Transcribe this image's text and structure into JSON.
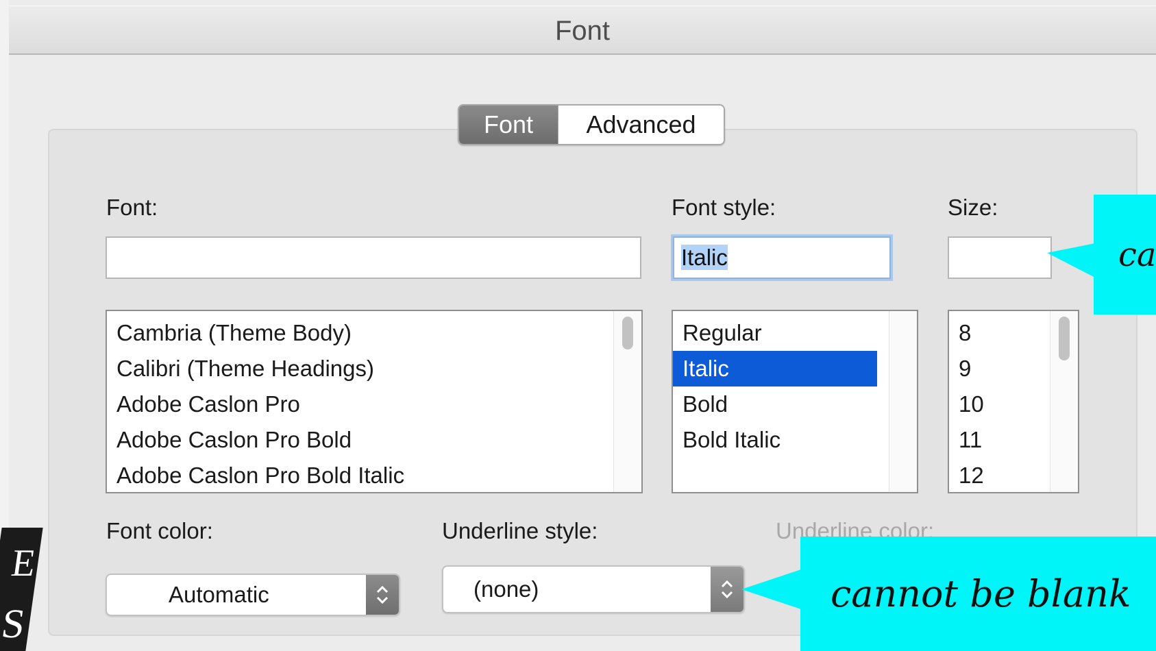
{
  "window": {
    "title": "Font"
  },
  "tabs": [
    {
      "label": "Font",
      "active": true
    },
    {
      "label": "Advanced",
      "active": false
    }
  ],
  "font": {
    "label": "Font:",
    "value": "",
    "list": [
      "Cambria (Theme Body)",
      "Calibri (Theme Headings)",
      "Adobe Caslon Pro",
      "Adobe Caslon Pro Bold",
      "Adobe Caslon Pro Bold Italic"
    ]
  },
  "font_style": {
    "label": "Font style:",
    "value": "Italic",
    "list": [
      "Regular",
      "Italic",
      "Bold",
      "Bold Italic"
    ],
    "selected_index": 1
  },
  "size": {
    "label": "Size:",
    "value": "",
    "list": [
      "8",
      "9",
      "10",
      "11",
      "12"
    ]
  },
  "font_color": {
    "label": "Font color:",
    "value": "Automatic"
  },
  "underline_style": {
    "label": "Underline style:",
    "value": "(none)"
  },
  "underline_color": {
    "label": "Underline color:"
  },
  "callouts": {
    "size_note": "ca",
    "underline_note": "cannot be blank"
  },
  "colors": {
    "callout": "#00f5f8",
    "selection": "#0e5bd7",
    "active_tab": "#6d6d6d"
  },
  "logo": {
    "text": "ES"
  }
}
